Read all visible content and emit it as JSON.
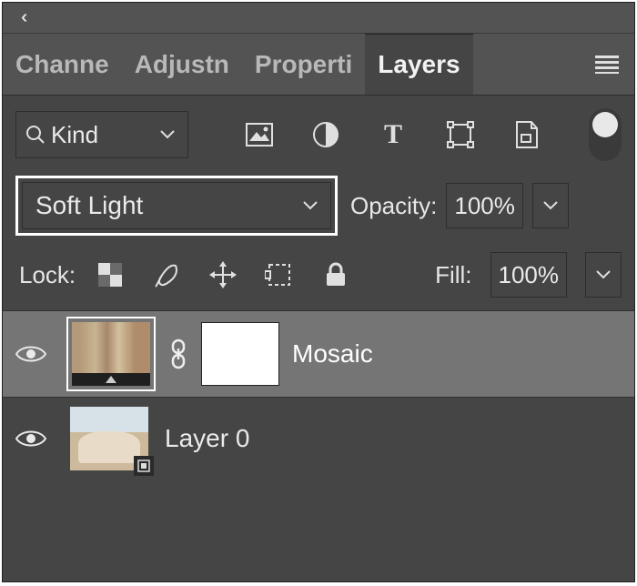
{
  "tabs": {
    "channels": "Channe",
    "adjustments": "Adjustn",
    "properties": "Properti",
    "layers": "Layers"
  },
  "filter": {
    "kind_label": "Kind"
  },
  "blend": {
    "mode": "Soft Light",
    "opacity_label": "Opacity:",
    "opacity_value": "100%"
  },
  "lock": {
    "label": "Lock:",
    "fill_label": "Fill:",
    "fill_value": "100%"
  },
  "layers": [
    {
      "name": "Mosaic"
    },
    {
      "name": "Layer 0"
    }
  ]
}
